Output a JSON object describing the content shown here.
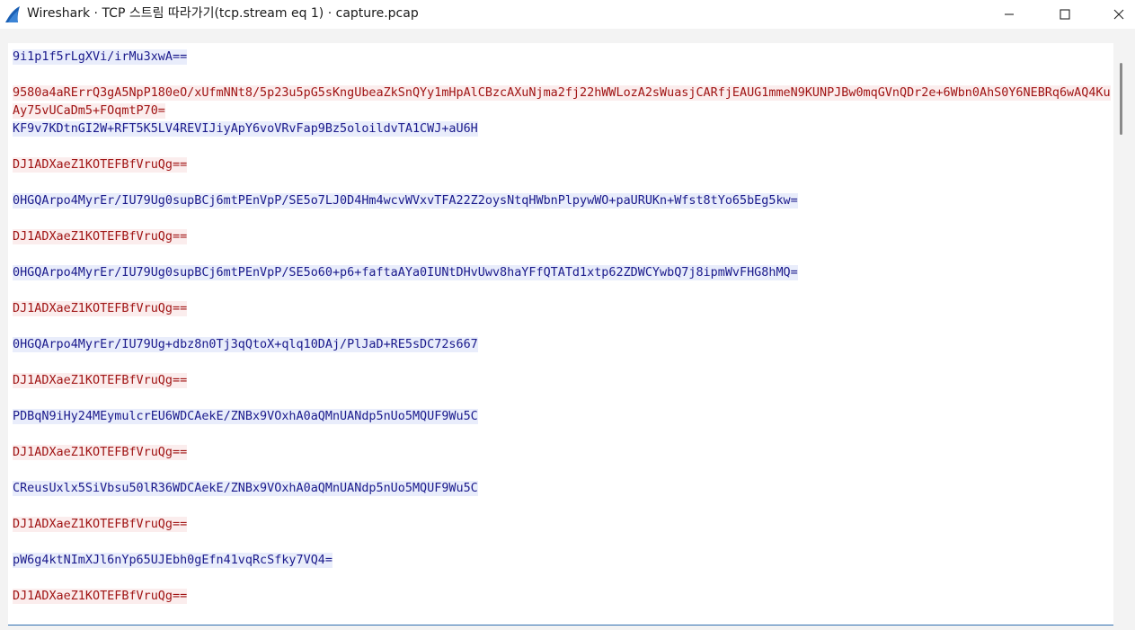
{
  "window": {
    "title": "Wireshark · TCP 스트림 따라가기(tcp.stream eq 1) · capture.pcap",
    "icon": "wireshark-fin-icon",
    "controls": [
      "minimize-icon",
      "maximize-icon",
      "close-icon"
    ]
  },
  "colors": {
    "client_text": "#1a1a8c",
    "client_bg": "#e9edfb",
    "server_text": "#a01414",
    "server_bg": "#fbeded"
  },
  "stream": {
    "lines": [
      {
        "dir": "client",
        "text": "9i1p1f5rLgXVi/irMu3xwA=="
      },
      {
        "dir": "server",
        "text": "9580a4aRErrQ3gA5NpP180eO/xUfmNNt8/5p23u5pG5sKngUbeaZkSnQYy1mHpAlCBzcAXuNjma2fj22hWWLozA2sWuasjCARfjEAUG1mmeN9KUNPJBw0mqGVnQDr2e+6Wbn0AhS0Y6NEBRq6wAQ4KuAy75vUCaDm5+FOqmtP70="
      },
      {
        "dir": "client",
        "text": "KF9v7KDtnGI2W+RFT5K5LV4REVIJiyApY6voVRvFap9Bz5oloildvTA1CWJ+aU6H"
      },
      {
        "dir": "server",
        "text": "DJ1ADXaeZ1KOTEFBfVruQg=="
      },
      {
        "dir": "client",
        "text": "0HGQArpo4MyrEr/IU79Ug0supBCj6mtPEnVpP/SE5o7LJ0D4Hm4wcvWVxvTFA22Z2oysNtqHWbnPlpywWO+paURUKn+Wfst8tYo65bEg5kw="
      },
      {
        "dir": "server",
        "text": "DJ1ADXaeZ1KOTEFBfVruQg=="
      },
      {
        "dir": "client",
        "text": "0HGQArpo4MyrEr/IU79Ug0supBCj6mtPEnVpP/SE5o60+p6+faftaAYa0IUNtDHvUwv8haYFfQTATd1xtp62ZDWCYwbQ7j8ipmWvFHG8hMQ="
      },
      {
        "dir": "server",
        "text": "DJ1ADXaeZ1KOTEFBfVruQg=="
      },
      {
        "dir": "client",
        "text": "0HGQArpo4MyrEr/IU79Ug+dbz8n0Tj3qQtoX+qlq10DAj/PlJaD+RE5sDC72s667"
      },
      {
        "dir": "server",
        "text": "DJ1ADXaeZ1KOTEFBfVruQg=="
      },
      {
        "dir": "client",
        "text": "PDBqN9iHy24MEymulcrEU6WDCAekE/ZNBx9VOxhA0aQMnUANdp5nUo5MQUF9Wu5C"
      },
      {
        "dir": "server",
        "text": "DJ1ADXaeZ1KOTEFBfVruQg=="
      },
      {
        "dir": "client",
        "text": "CReusUxlx5SiVbsu50lR36WDCAekE/ZNBx9VOxhA0aQMnUANdp5nUo5MQUF9Wu5C"
      },
      {
        "dir": "server",
        "text": "DJ1ADXaeZ1KOTEFBfVruQg=="
      },
      {
        "dir": "client",
        "text": "pW6g4ktNImXJl6nYp65UJEbh0gEfn41vqRcSfky7VQ4="
      },
      {
        "dir": "server",
        "text": "DJ1ADXaeZ1KOTEFBfVruQg=="
      }
    ]
  }
}
